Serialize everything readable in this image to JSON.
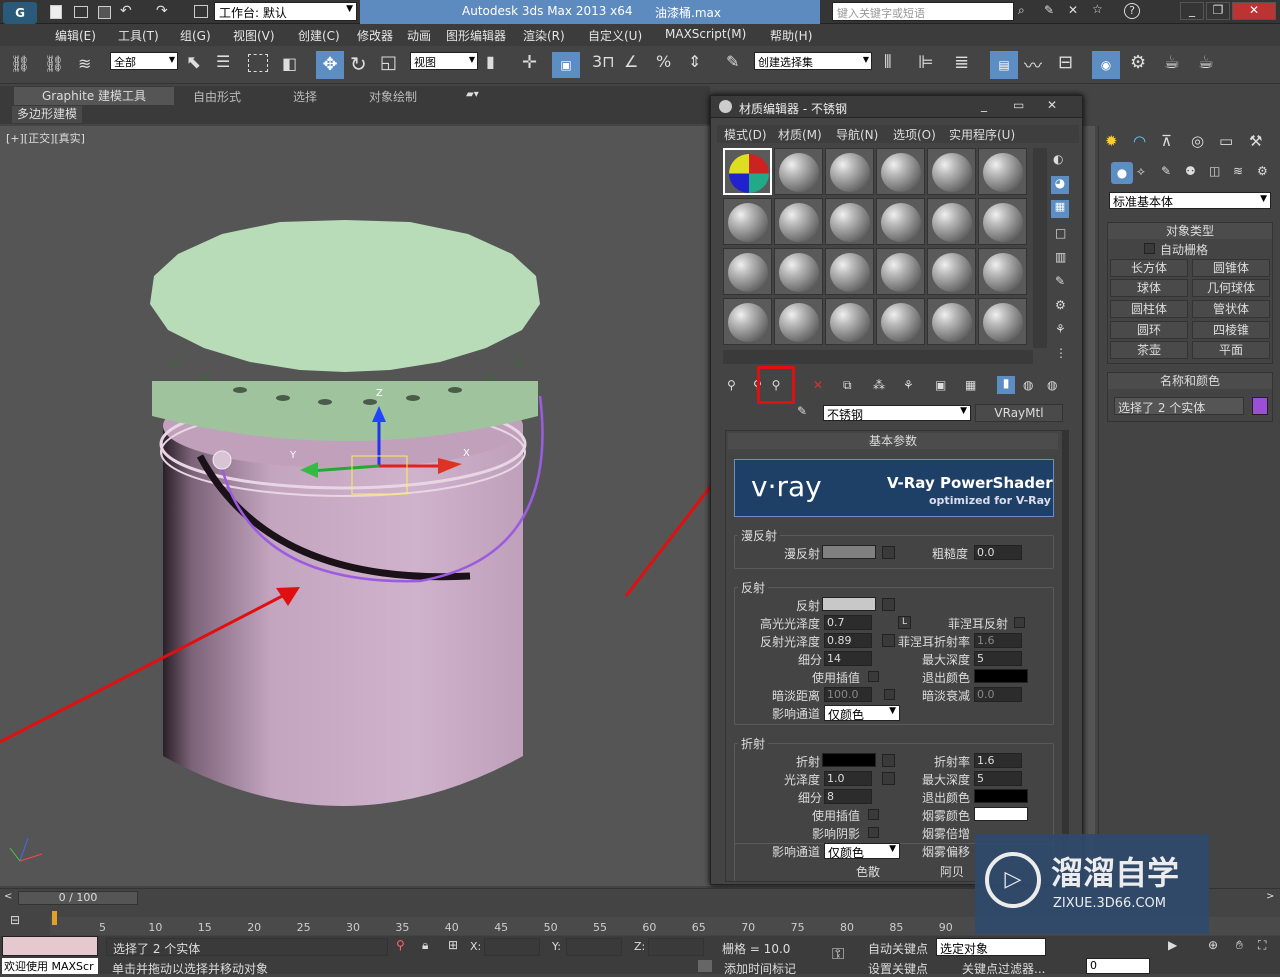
{
  "app": {
    "title": "Autodesk 3ds Max  2013 x64",
    "file": "油漆桶.max",
    "workspace": "工作台: 默认",
    "search_placeholder": "键入关键字或短语"
  },
  "menu": [
    "编辑(E)",
    "工具(T)",
    "组(G)",
    "视图(V)",
    "创建(C)",
    "修改器",
    "动画",
    "图形编辑器",
    "渲染(R)",
    "自定义(U)",
    "MAXScript(M)",
    "帮助(H)"
  ],
  "toolbar": {
    "selection_filter": "全部",
    "ref_coord": "视图",
    "named_selection": "创建选择集"
  },
  "ribbon": {
    "tabs": [
      "Graphite 建模工具",
      "自由形式",
      "选择",
      "对象绘制"
    ],
    "sub_tab": "多边形建模"
  },
  "viewport": {
    "label": "[+][正交][真实]"
  },
  "material_editor": {
    "title": "材质编辑器 - 不锈钢",
    "menu": [
      "模式(D)",
      "材质(M)",
      "导航(N)",
      "选项(O)",
      "实用程序(U)"
    ],
    "material_name": "不锈钢",
    "material_type": "VRayMtl",
    "rollout_title": "基本参数",
    "banner_brand": "v·ray",
    "banner_product": "V-Ray PowerShader",
    "banner_sub": "optimized for V-Ray",
    "diffuse_group": "漫反射",
    "diffuse_label": "漫反射",
    "roughness_label": "粗糙度",
    "roughness_value": "0.0",
    "reflect_group": "反射",
    "reflect_label": "反射",
    "hilight_gloss_label": "高光光泽度",
    "hilight_gloss_value": "0.7",
    "refl_gloss_label": "反射光泽度",
    "refl_gloss_value": "0.89",
    "refl_subdivs_label": "细分",
    "refl_subdivs_value": "14",
    "use_interp_label": "使用插值",
    "dim_dist_label": "暗淡距离",
    "dim_dist_value": "100.0",
    "affect_channels_label": "影响通道",
    "affect_channels_value": "仅颜色",
    "fresnel_label": "菲涅耳反射",
    "fresnel_ior_label": "菲涅耳折射率",
    "fresnel_ior_value": "1.6",
    "max_depth_label": "最大深度",
    "max_depth_value": "5",
    "exit_color_label": "退出颜色",
    "dim_falloff_label": "暗淡衰减",
    "dim_falloff_value": "0.0",
    "lock_label": "L",
    "refract_group": "折射",
    "refract_label": "折射",
    "refr_gloss_label": "光泽度",
    "refr_gloss_value": "1.0",
    "refr_subdivs_label": "细分",
    "refr_subdivs_value": "8",
    "refr_use_interp_label": "使用插值",
    "affect_shadows_label": "影响阴影",
    "refr_affect_channels_label": "影响通道",
    "refr_affect_channels_value": "仅颜色",
    "ior_label": "折射率",
    "ior_value": "1.6",
    "refr_max_depth_label": "最大深度",
    "refr_max_depth_value": "5",
    "refr_exit_color_label": "退出颜色",
    "fog_color_label": "烟雾颜色",
    "fog_mult_label": "烟雾倍增",
    "fog_bias_label": "烟雾偏移",
    "dispersion_label": "色散",
    "abbe_label": "阿贝"
  },
  "command_panel": {
    "category": "标准基本体",
    "object_type_title": "对象类型",
    "autogrid_label": "自动栅格",
    "objects": [
      "长方体",
      "圆锥体",
      "球体",
      "几何球体",
      "圆柱体",
      "管状体",
      "圆环",
      "四棱锥",
      "茶壶",
      "平面"
    ],
    "name_color_title": "名称和颜色",
    "name_value": "选择了 2 个实体",
    "object_color": "#9b4fd6"
  },
  "timeline": {
    "frame": "0 / 100",
    "ticks": [
      "5",
      "10",
      "15",
      "20",
      "25",
      "30",
      "35",
      "40",
      "45",
      "50",
      "55",
      "60",
      "65",
      "70",
      "75",
      "80",
      "85",
      "90"
    ]
  },
  "status": {
    "script_label": "欢迎使用 MAXScr",
    "selection_info": "选择了 2 个实体",
    "hint": "单击并拖动以选择并移动对象",
    "x_label": "X:",
    "y_label": "Y:",
    "z_label": "Z:",
    "grid": "栅格 = 10.0",
    "auto_key": "自动关键点",
    "set_key": "设置关键点",
    "selected_dropdown": "选定对象",
    "key_filters": "关键点过滤器...",
    "add_time_tag": "添加时间标记",
    "frame_field": "0"
  },
  "watermark": {
    "brand": "溜溜自学",
    "url": "ZIXUE.3D66.COM"
  },
  "colors": {
    "bucket_body": "#c9a9c4",
    "bucket_lid": "#b9dcb8",
    "handle": "#9b5ce0",
    "annotation_red": "#e01010",
    "watermark_bg": "#2f4a6e"
  }
}
